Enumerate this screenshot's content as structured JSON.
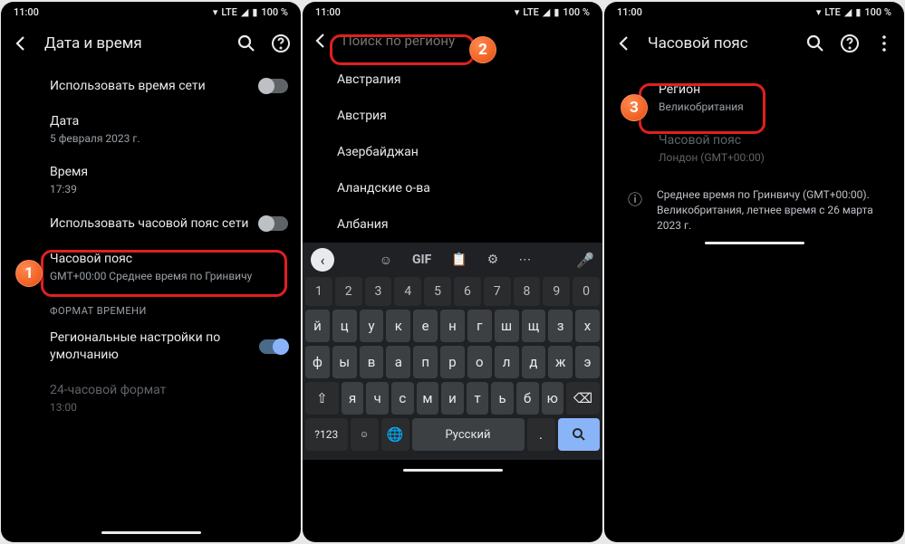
{
  "status": {
    "time": "11:00",
    "net": "LTE",
    "battery": "100 %"
  },
  "p1": {
    "title": "Дата и время",
    "useNetTime": "Использовать время сети",
    "date_l": "Дата",
    "date_v": "5 февраля 2023 г.",
    "time_l": "Время",
    "time_v": "17:39",
    "useNetTz": "Использовать часовой пояс сети",
    "tz_l": "Часовой пояс",
    "tz_v": "GMT+00:00 Среднее время по Гринвичу",
    "section": "ФОРМАТ ВРЕМЕНИ",
    "locale_l": "Региональные настройки по умолчанию",
    "h24_l": "24-часовой формат",
    "h24_v": "13:00",
    "badge": "1"
  },
  "p2": {
    "placeholder": "Поиск по региону",
    "regions": [
      "Австралия",
      "Австрия",
      "Азербайджан",
      "Аландские о-ва",
      "Албания"
    ],
    "kbd_gif": "GIF",
    "kbd_space": "Русский",
    "kbd_sym": "?123",
    "badge": "2",
    "rows": {
      "nums": [
        "1",
        "2",
        "3",
        "4",
        "5",
        "6",
        "7",
        "8",
        "9",
        "0"
      ],
      "r1": [
        "й",
        "ц",
        "у",
        "к",
        "е",
        "н",
        "г",
        "ш",
        "щ",
        "з",
        "х"
      ],
      "r2": [
        "ф",
        "ы",
        "в",
        "а",
        "п",
        "р",
        "о",
        "л",
        "д",
        "ж",
        "э"
      ],
      "r3": [
        "я",
        "ч",
        "с",
        "м",
        "и",
        "т",
        "ь",
        "б",
        "ю"
      ]
    }
  },
  "p3": {
    "title": "Часовой пояс",
    "region_l": "Регион",
    "region_v": "Великобритания",
    "tz_l": "Часовой пояс",
    "tz_v": "Лондон (GMT+00:00)",
    "info": "Среднее время по Гринвичу (GMT+00:00). Великобритания, летнее время с 26 марта 2023 г.",
    "badge": "3"
  }
}
